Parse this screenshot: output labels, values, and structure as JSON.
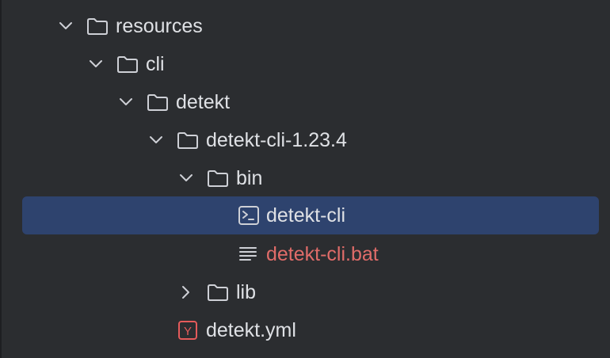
{
  "colors": {
    "background": "#2b2d30",
    "selection": "#2e436e",
    "text": "#dfe1e5",
    "modified_text": "#e06c69",
    "icon": "#ced0d6",
    "yaml_icon": "#e55b5b"
  },
  "tree": {
    "items": [
      {
        "label": "resources",
        "icon": "folder-icon",
        "state": "expanded"
      },
      {
        "label": "cli",
        "icon": "folder-icon",
        "state": "expanded"
      },
      {
        "label": "detekt",
        "icon": "folder-icon",
        "state": "expanded"
      },
      {
        "label": "detekt-cli-1.23.4",
        "icon": "folder-icon",
        "state": "expanded"
      },
      {
        "label": "bin",
        "icon": "folder-icon",
        "state": "expanded"
      },
      {
        "label": "detekt-cli",
        "icon": "terminal-script-icon",
        "selected": true
      },
      {
        "label": "detekt-cli.bat",
        "icon": "text-file-icon",
        "status": "modified"
      },
      {
        "label": "lib",
        "icon": "folder-icon",
        "state": "collapsed"
      },
      {
        "label": "detekt.yml",
        "icon": "yaml-file-icon",
        "icon_letter": "Y"
      }
    ]
  }
}
